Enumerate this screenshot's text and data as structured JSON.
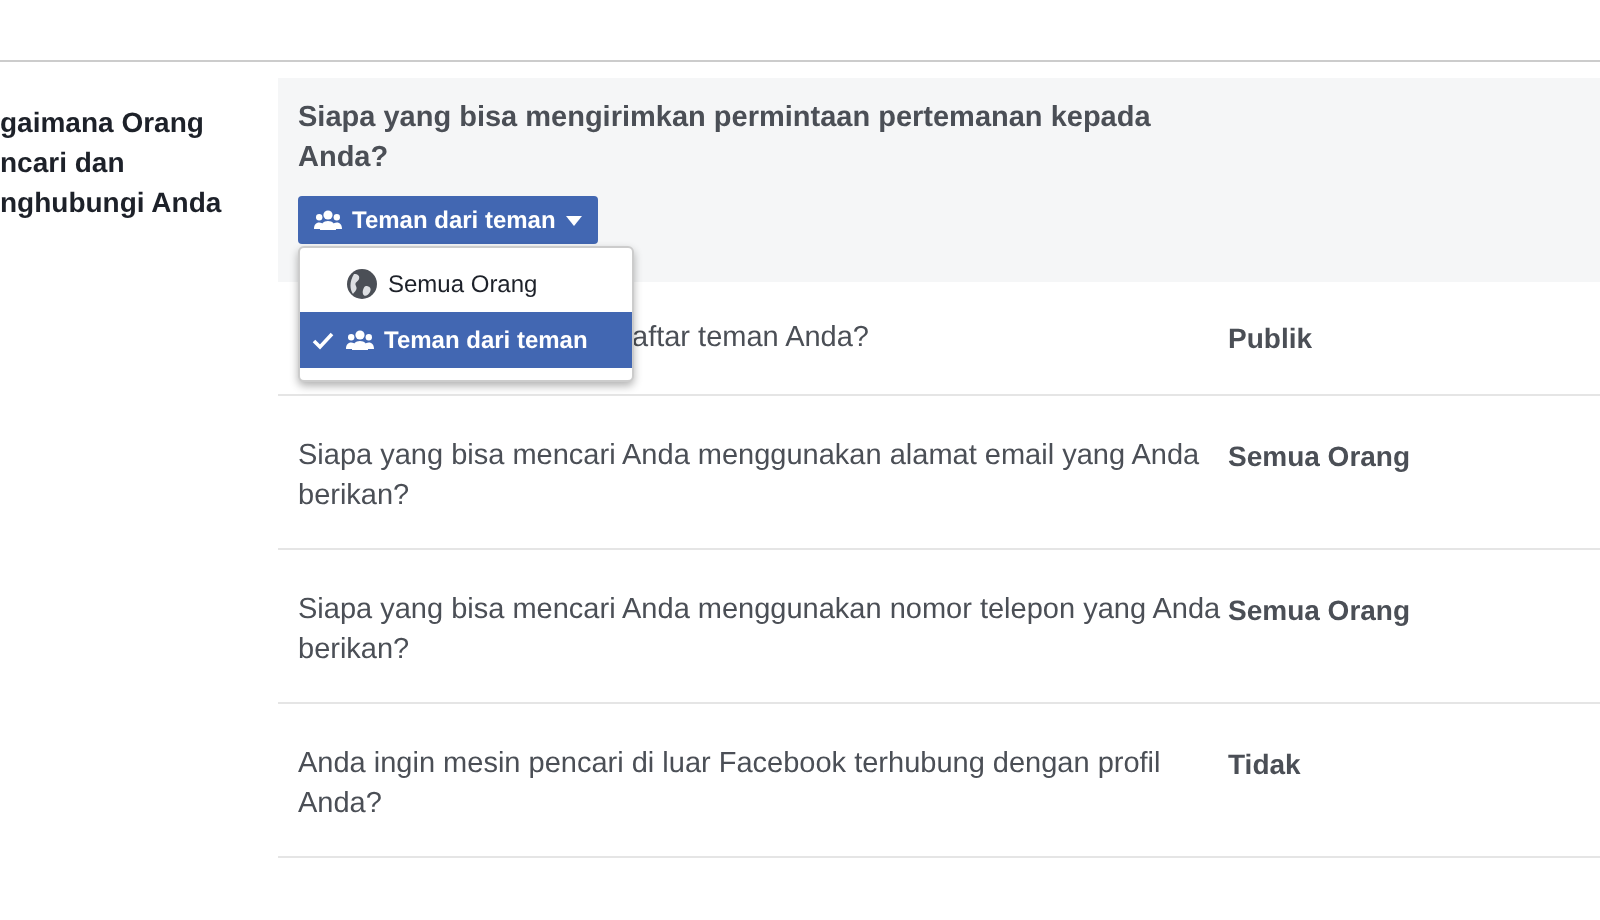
{
  "section_title_lines": [
    "gaimana Orang",
    "ncari dan",
    "nghubungi Anda"
  ],
  "expanded": {
    "question": "Siapa yang bisa mengirimkan permintaan pertemanan kepada Anda?",
    "button": "Teman dari teman",
    "menu": [
      {
        "label": "Semua Orang",
        "kind": "globe",
        "selected": false
      },
      {
        "label": "Teman dari teman",
        "kind": "people",
        "selected": true
      }
    ]
  },
  "rows": [
    {
      "question": "aftar teman Anda?",
      "value": "Publik"
    },
    {
      "question": "Siapa yang bisa mencari Anda menggunakan alamat email yang Anda berikan?",
      "value": "Semua Orang"
    },
    {
      "question": "Siapa yang bisa mencari Anda menggunakan nomor telepon yang Anda berikan?",
      "value": "Semua Orang"
    },
    {
      "question": "Anda ingin mesin pencari di luar Facebook terhubung dengan profil Anda?",
      "value": "Tidak"
    }
  ]
}
